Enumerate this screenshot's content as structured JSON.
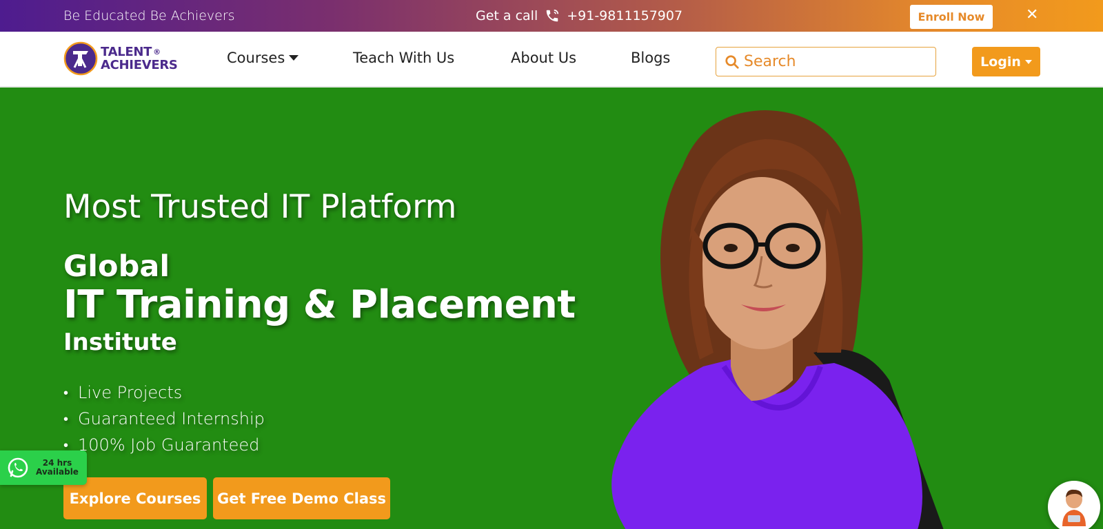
{
  "topbar": {
    "tagline": "Be Educated Be Achievers",
    "call_label": "Get a call",
    "phone": "+91-9811157907",
    "enroll_label": "Enroll Now",
    "close_symbol": "✕"
  },
  "logo": {
    "line1": "TALENT",
    "line2": "ACHIEVERS",
    "reg": "®",
    "icon": "talent-achievers-logo-icon"
  },
  "nav": {
    "items": [
      {
        "label": "Courses",
        "dropdown": true
      },
      {
        "label": "Teach With Us"
      },
      {
        "label": "About Us"
      },
      {
        "label": "Blogs"
      }
    ],
    "search_placeholder": "Search",
    "login_label": "Login"
  },
  "hero": {
    "headline": "Most Trusted IT Platform",
    "line_global": "Global",
    "line_training": "IT Training & Placement",
    "line_institute": "Institute",
    "bullets": [
      "Live Projects",
      "Guaranteed Internship",
      "100% Job Guaranteed"
    ],
    "cta_primary": "Explore Courses",
    "cta_secondary": "Get Free Demo Class",
    "bg_color": "#228c12"
  },
  "whatsapp": {
    "line1": "24 hrs",
    "line2": "Available"
  },
  "colors": {
    "accent": "#f29a1c",
    "brand_purple": "#4b2a8c"
  }
}
